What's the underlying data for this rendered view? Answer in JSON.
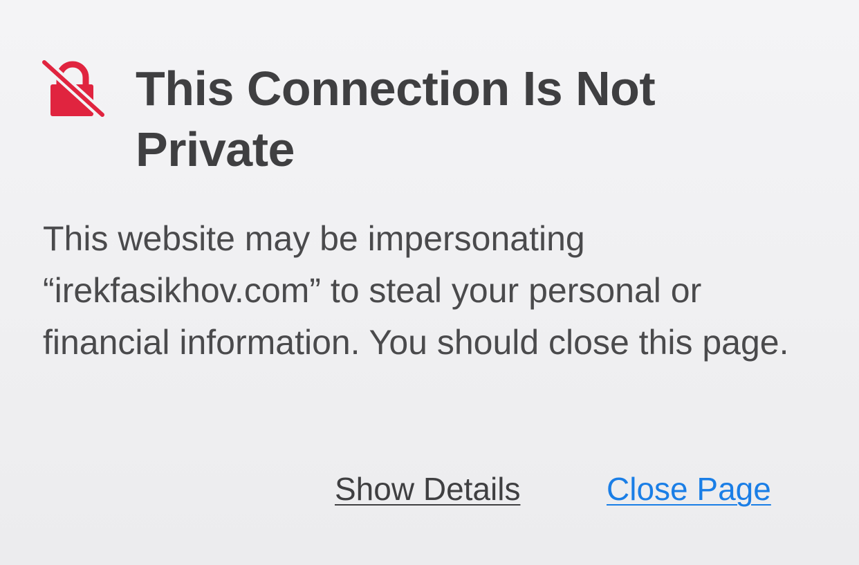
{
  "icon": {
    "name": "lock-slash-icon",
    "color": "#e0243f"
  },
  "warning": {
    "title": "This Connection Is Not Private",
    "body": "This website may be impersonating “irekfasikhov.com” to steal your personal or financial information. You should close this page."
  },
  "actions": {
    "show_details_label": "Show Details",
    "close_page_label": "Close Page"
  },
  "colors": {
    "text": "#3f3f41",
    "link": "#1a7ee6",
    "icon": "#e0243f",
    "background": "#f1f1f3"
  }
}
